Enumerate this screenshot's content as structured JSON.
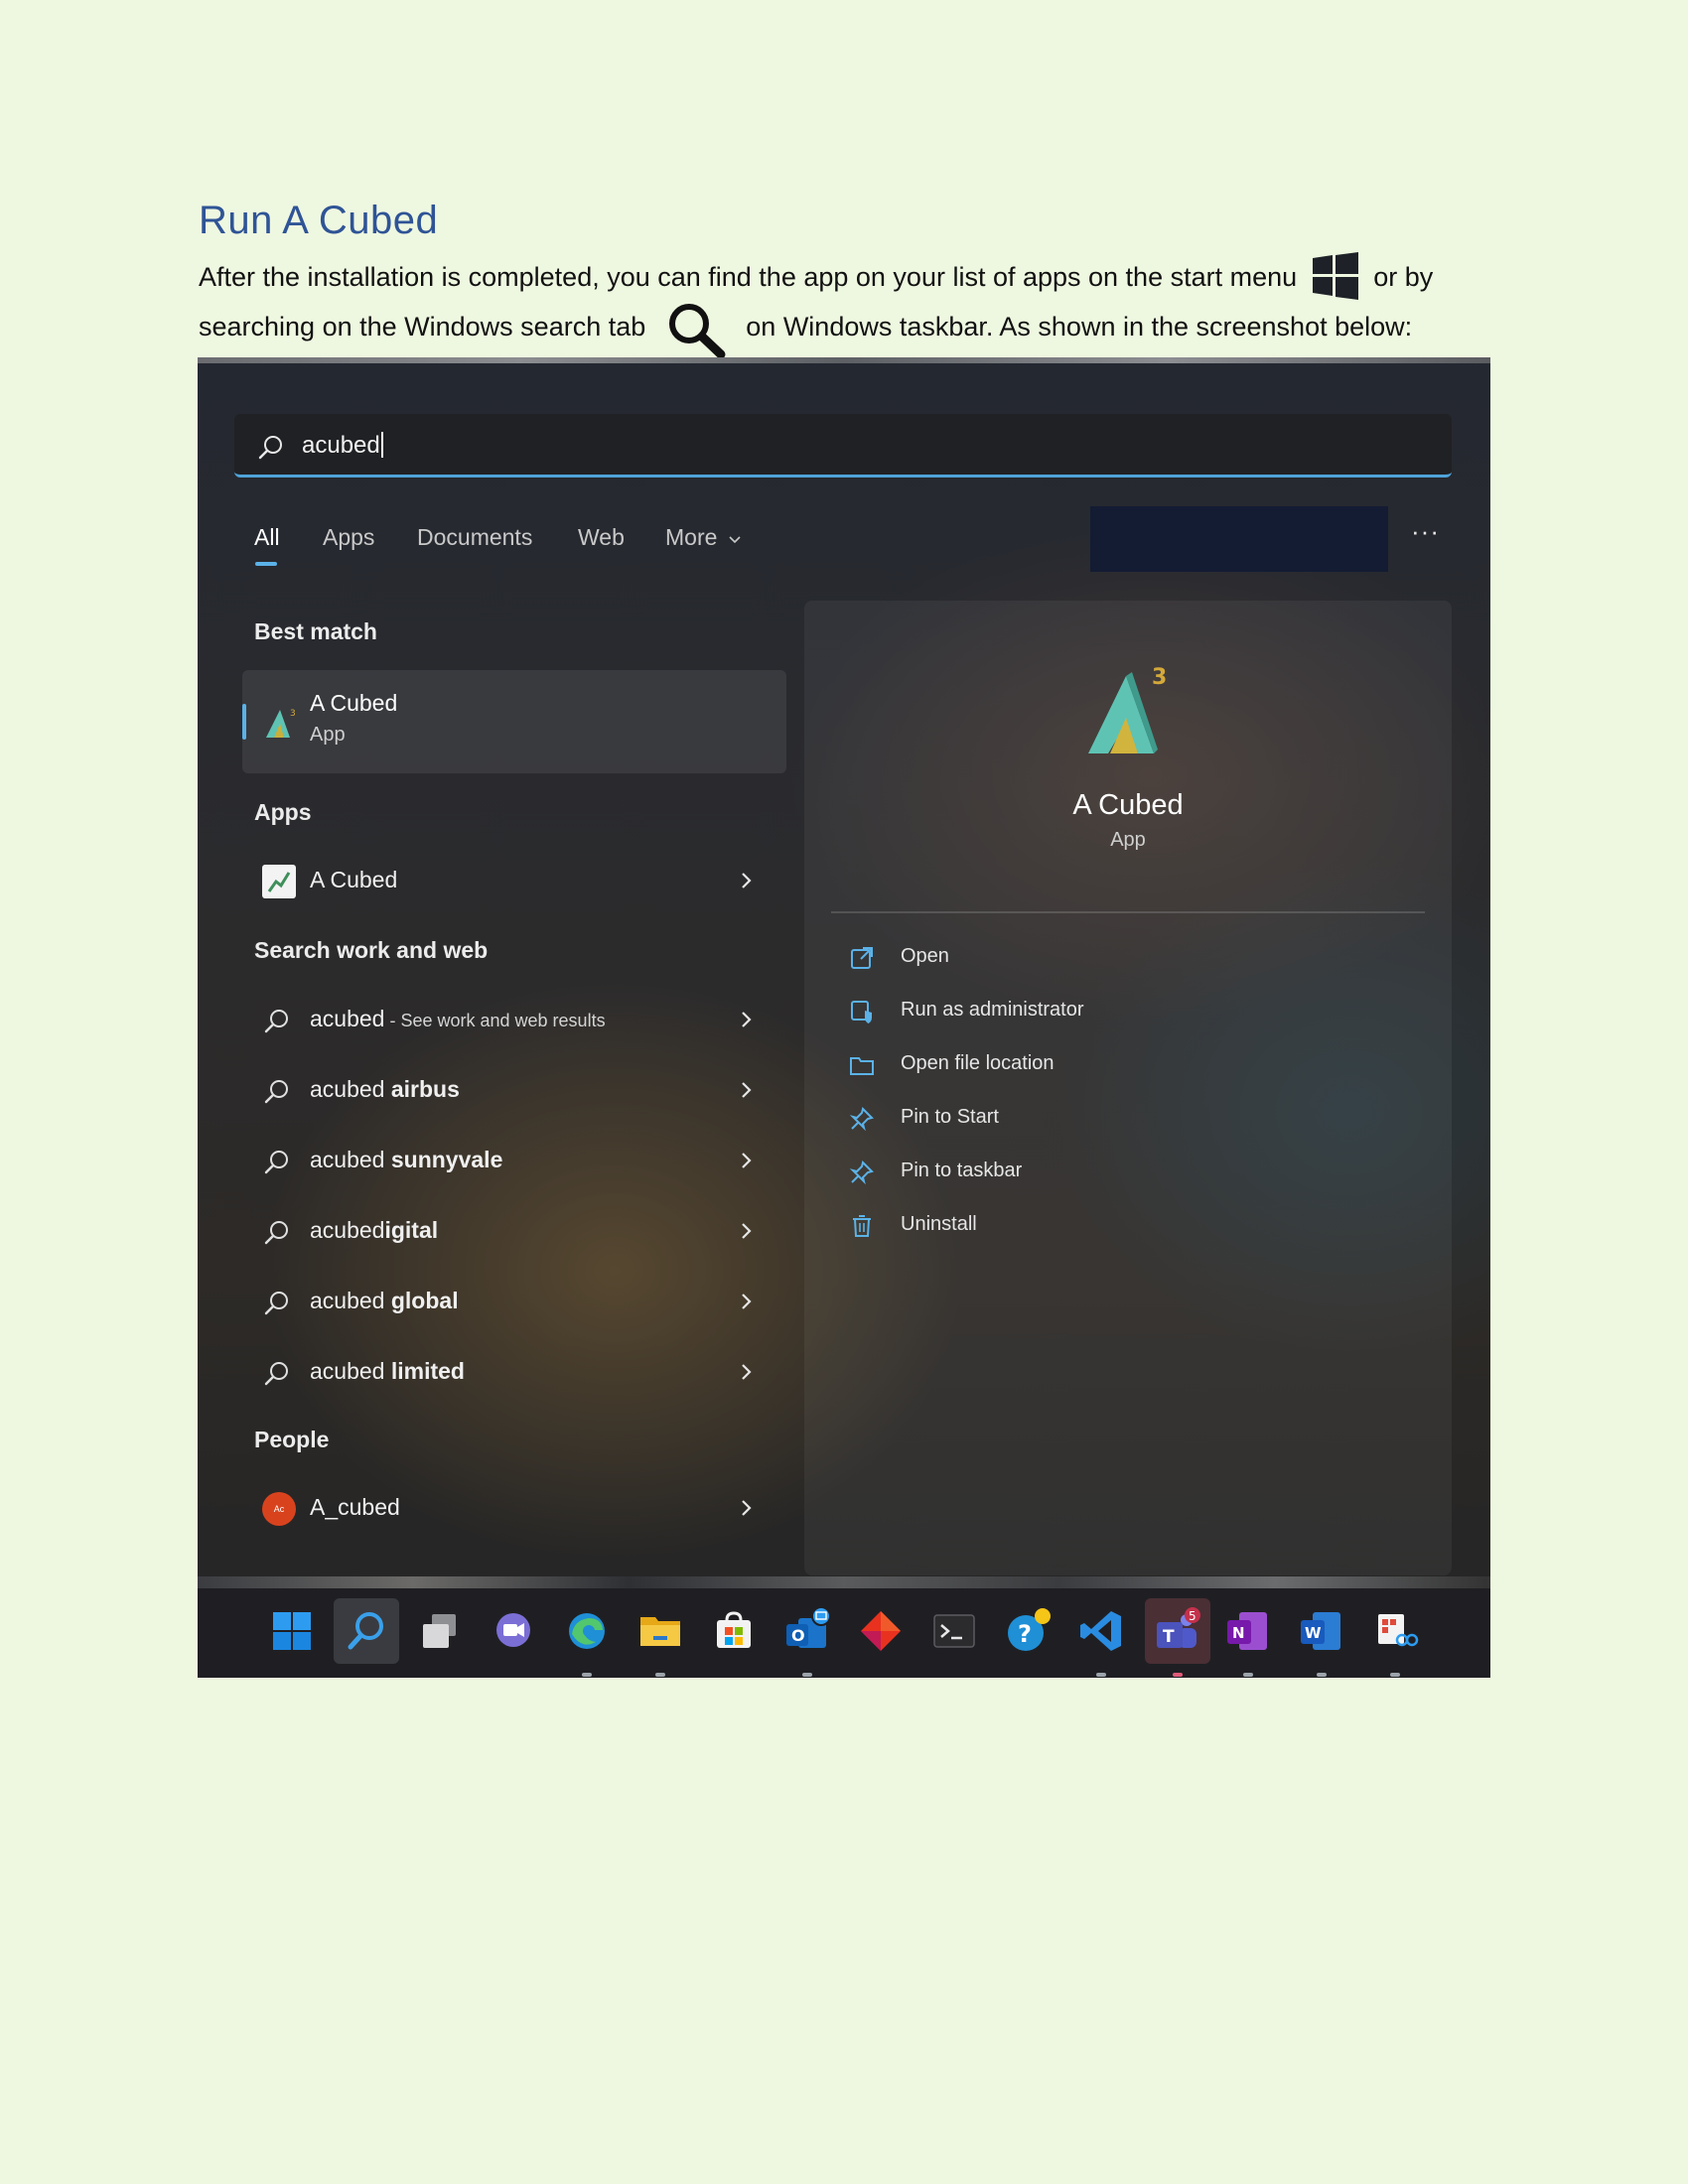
{
  "document": {
    "heading": "Run A Cubed",
    "para_part1": "After the installation is completed, you can find the app on your list of apps on the start menu",
    "para_part2": "or by searching on the Windows search tab",
    "para_part3": "on Windows taskbar. As shown in the screenshot below:"
  },
  "search": {
    "query": "acubed"
  },
  "tabs": [
    "All",
    "Apps",
    "Documents",
    "Web",
    "More"
  ],
  "sections": {
    "best_match": "Best match",
    "apps": "Apps",
    "search_web": "Search work and web",
    "people": "People"
  },
  "best_match": {
    "name": "A Cubed",
    "type": "App"
  },
  "apps": [
    {
      "name": "A Cubed"
    }
  ],
  "web_results": [
    {
      "prefix": "acubed",
      "bold": "",
      "suffix": " - See work and web results"
    },
    {
      "prefix": "acubed ",
      "bold": "airbus",
      "suffix": ""
    },
    {
      "prefix": "acubed ",
      "bold": "sunnyvale",
      "suffix": ""
    },
    {
      "prefix": "acubed",
      "bold": "igital",
      "suffix": ""
    },
    {
      "prefix": "acubed ",
      "bold": "global",
      "suffix": ""
    },
    {
      "prefix": "acubed ",
      "bold": "limited",
      "suffix": ""
    }
  ],
  "people": [
    {
      "name": "A_cubed",
      "initials": "Ac"
    }
  ],
  "detail": {
    "name": "A Cubed",
    "type": "App",
    "actions": [
      {
        "label": "Open",
        "icon": "open-icon"
      },
      {
        "label": "Run as administrator",
        "icon": "shield-icon"
      },
      {
        "label": "Open file location",
        "icon": "folder-icon"
      },
      {
        "label": "Pin to Start",
        "icon": "pin-icon"
      },
      {
        "label": "Pin to taskbar",
        "icon": "pin-icon"
      },
      {
        "label": "Uninstall",
        "icon": "trash-icon"
      }
    ]
  },
  "taskbar": {
    "teams_badge": "5",
    "icons": [
      "windows-start-icon",
      "search-icon",
      "task-view-icon",
      "chat-icon",
      "edge-icon",
      "file-explorer-icon",
      "store-icon",
      "outlook-icon",
      "git-icon",
      "terminal-icon",
      "help-icon",
      "vscode-icon",
      "teams-icon",
      "onenote-icon",
      "word-icon",
      "snipping-icon"
    ]
  },
  "colors": {
    "accent": "#5bb2e8",
    "heading": "#2f5496",
    "page_bg": "#eef7e0"
  }
}
